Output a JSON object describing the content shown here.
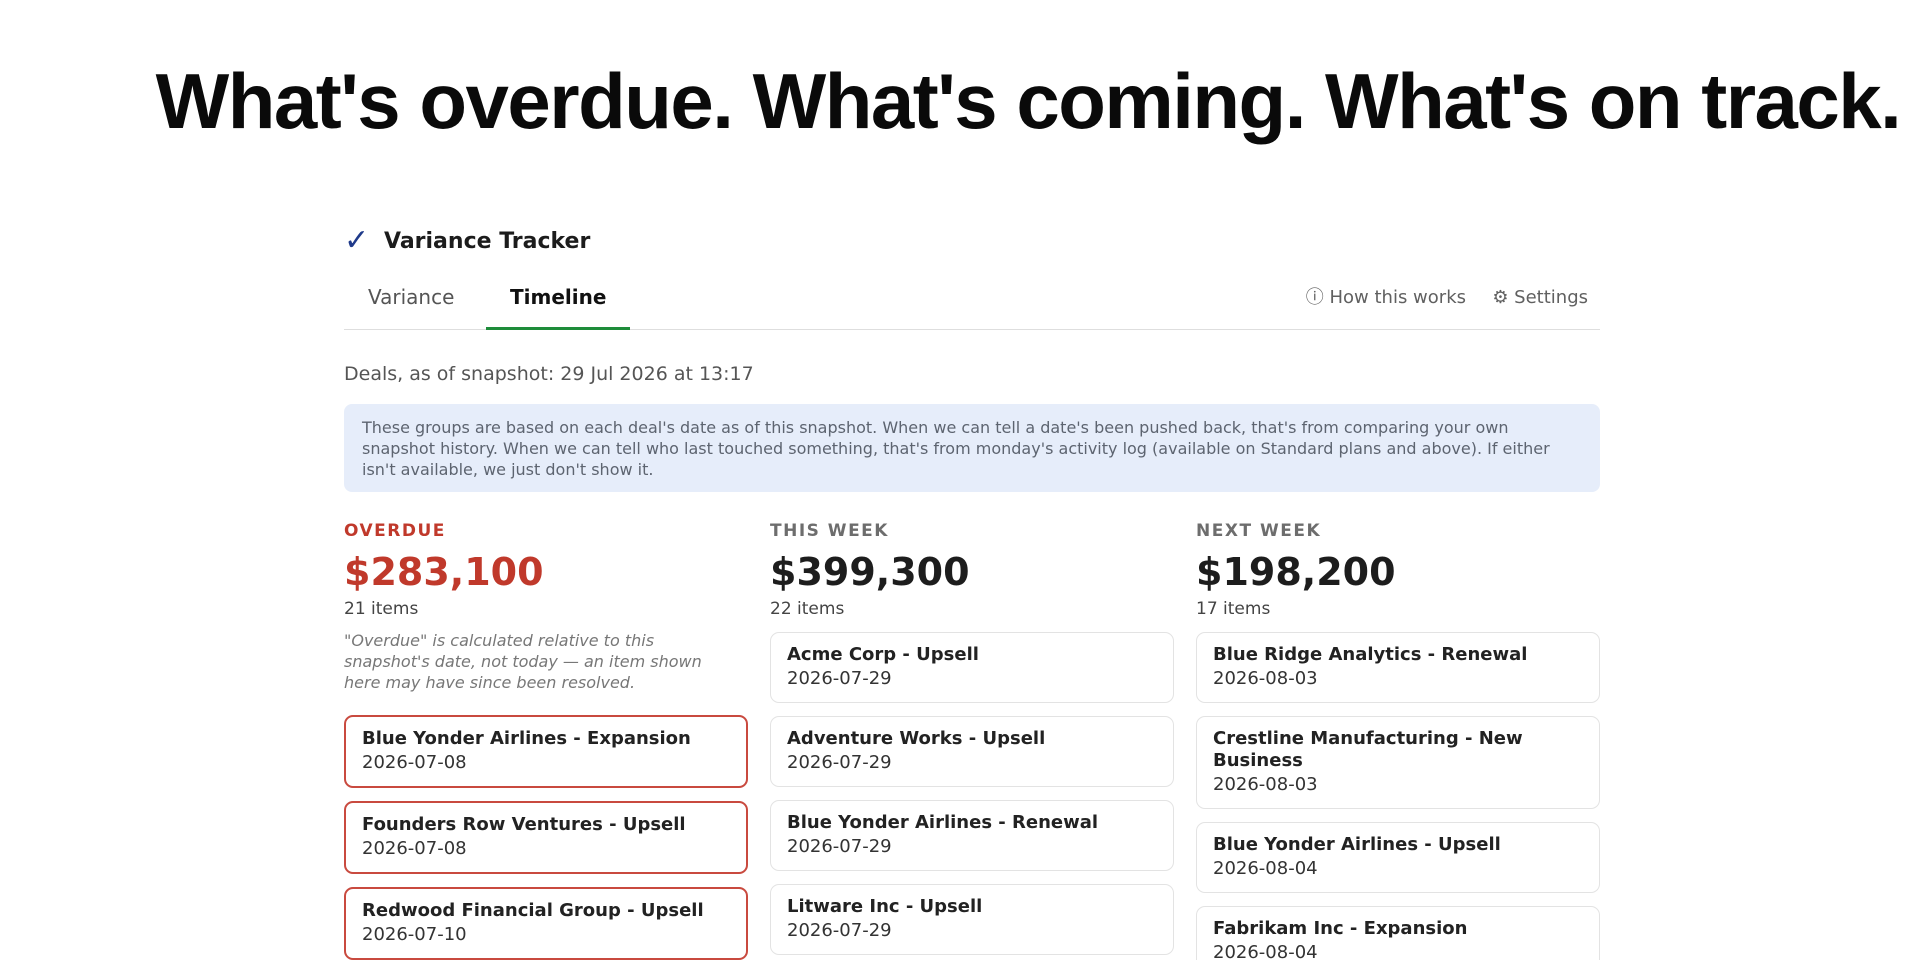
{
  "headline": "What's overdue. What's coming. What's on track.",
  "app": {
    "brand_icon": "check-icon",
    "name": "Variance Tracker"
  },
  "tabs": {
    "variance": "Variance",
    "timeline": "Timeline",
    "active": "Timeline",
    "active_color": "#1e8c3a",
    "how_it_works": "ⓘ How this works",
    "settings": "⚙ Settings"
  },
  "snapshot_text": "Deals, as of snapshot: 29 Jul 2026 at 13:17",
  "info_text": "These groups are based on each deal's date as of this snapshot. When we can tell a date's been pushed back, that's from comparing your own snapshot history. When we can tell who last touched something, that's from monday's activity log (available on Standard plans and above). If either isn't available, we just don't show it.",
  "columns": {
    "overdue": {
      "label": "OVERDUE",
      "total": "$283,100",
      "count": "21 items",
      "color": "#c0392b",
      "note": "\"Overdue\" is calculated relative to this snapshot's date, not today — an item shown here may have since been resolved.",
      "items": [
        {
          "title": "Blue Yonder Airlines - Expansion",
          "date": "2026-07-08"
        },
        {
          "title": "Founders Row Ventures - Upsell",
          "date": "2026-07-08"
        },
        {
          "title": "Redwood Financial Group - Upsell",
          "date": "2026-07-10"
        }
      ]
    },
    "this_week": {
      "label": "THIS WEEK",
      "total": "$399,300",
      "count": "22 items",
      "items": [
        {
          "title": "Acme Corp - Upsell",
          "date": "2026-07-29"
        },
        {
          "title": "Adventure Works - Upsell",
          "date": "2026-07-29"
        },
        {
          "title": "Blue Yonder Airlines - Renewal",
          "date": "2026-07-29"
        },
        {
          "title": "Litware Inc - Upsell",
          "date": "2026-07-29"
        }
      ]
    },
    "next_week": {
      "label": "NEXT WEEK",
      "total": "$198,200",
      "count": "17 items",
      "items": [
        {
          "title": "Blue Ridge Analytics - Renewal",
          "date": "2026-08-03"
        },
        {
          "title": "Crestline Manufacturing - New Business",
          "date": "2026-08-03"
        },
        {
          "title": "Blue Yonder Airlines - Upsell",
          "date": "2026-08-04"
        },
        {
          "title": "Fabrikam Inc - Expansion",
          "date": "2026-08-04"
        }
      ]
    }
  }
}
